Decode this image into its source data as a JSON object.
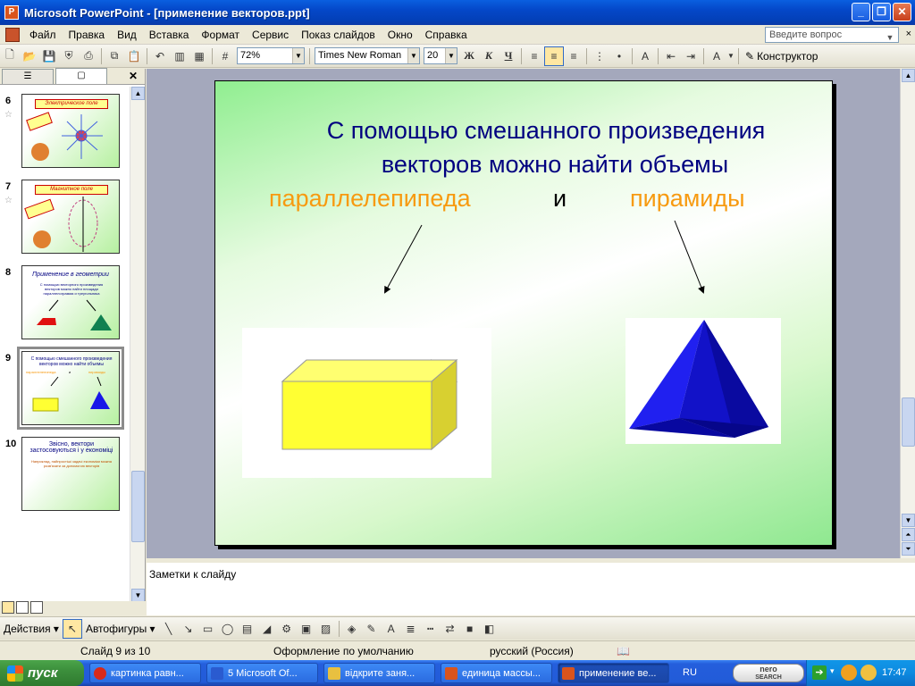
{
  "window": {
    "title": "Microsoft PowerPoint - [применение векторов.ppt]",
    "buttons": [
      "_",
      "❐",
      "✕"
    ]
  },
  "menu": {
    "items": [
      "Файл",
      "Правка",
      "Вид",
      "Вставка",
      "Формат",
      "Сервис",
      "Показ слайдов",
      "Окно",
      "Справка"
    ],
    "help_placeholder": "Введите вопрос",
    "close": "×"
  },
  "toolbar": {
    "zoom": "72%",
    "font": "Times New Roman",
    "font_size": "20",
    "bold": "Ж",
    "italic": "К",
    "underline": "Ч",
    "designer": "Конструктор"
  },
  "slide_panel": {
    "slides": [
      {
        "num": "6",
        "title": "Электрическое поле",
        "star": "☆"
      },
      {
        "num": "7",
        "title": "Магнитное поле",
        "star": "☆"
      },
      {
        "num": "8",
        "title": "Применение в геометрии",
        "text": "С помощью векторного произведения векторов можно найти площади параллелограмма и треугольника"
      },
      {
        "num": "9",
        "text": "С помощью смешанного произведения векторов можно найти объемы",
        "w1": "параллелепипеда",
        "w2": "и",
        "w3": "пирамиды"
      },
      {
        "num": "10",
        "title": "Звісно, вектори застосовуються і у економіці",
        "text": "Наприклад, найпростіші задачі економіки можна розв'язати за допомогою векторів"
      }
    ]
  },
  "slide": {
    "title_line1": "С помощью смешанного произведения",
    "title_line2": "векторов можно найти объемы",
    "word1": "параллелепипеда",
    "word2": "и",
    "word3": "пирамиды"
  },
  "notes": {
    "placeholder": "Заметки к слайду"
  },
  "drawing_toolbar": {
    "actions": "Действия",
    "autoshapes": "Автофигуры"
  },
  "status": {
    "slide": "Слайд 9 из 10",
    "design": "Оформление по умолчанию",
    "language": "русский (Россия)"
  },
  "taskbar": {
    "start": "пуск",
    "tasks": [
      {
        "label": "картинка равн...",
        "color": "#d82a1a"
      },
      {
        "label": "5 Microsoft Of...",
        "color": "#2a5bd0"
      },
      {
        "label": "відкрите заня...",
        "color": "#e8c040"
      },
      {
        "label": "единица массы...",
        "color": "#d9541d"
      },
      {
        "label": "применение ве...",
        "color": "#d9541d"
      }
    ],
    "lang": "RU",
    "nero_line1": "nero",
    "nero_line2": "SEARCH",
    "clock": "17:47"
  },
  "colors": {
    "accent": "#0a5fe0",
    "title_text": "#000080",
    "highlight_word": "#f79a10",
    "box_yellow": "#ffff33",
    "pyramid_blue": "#1818e8"
  }
}
